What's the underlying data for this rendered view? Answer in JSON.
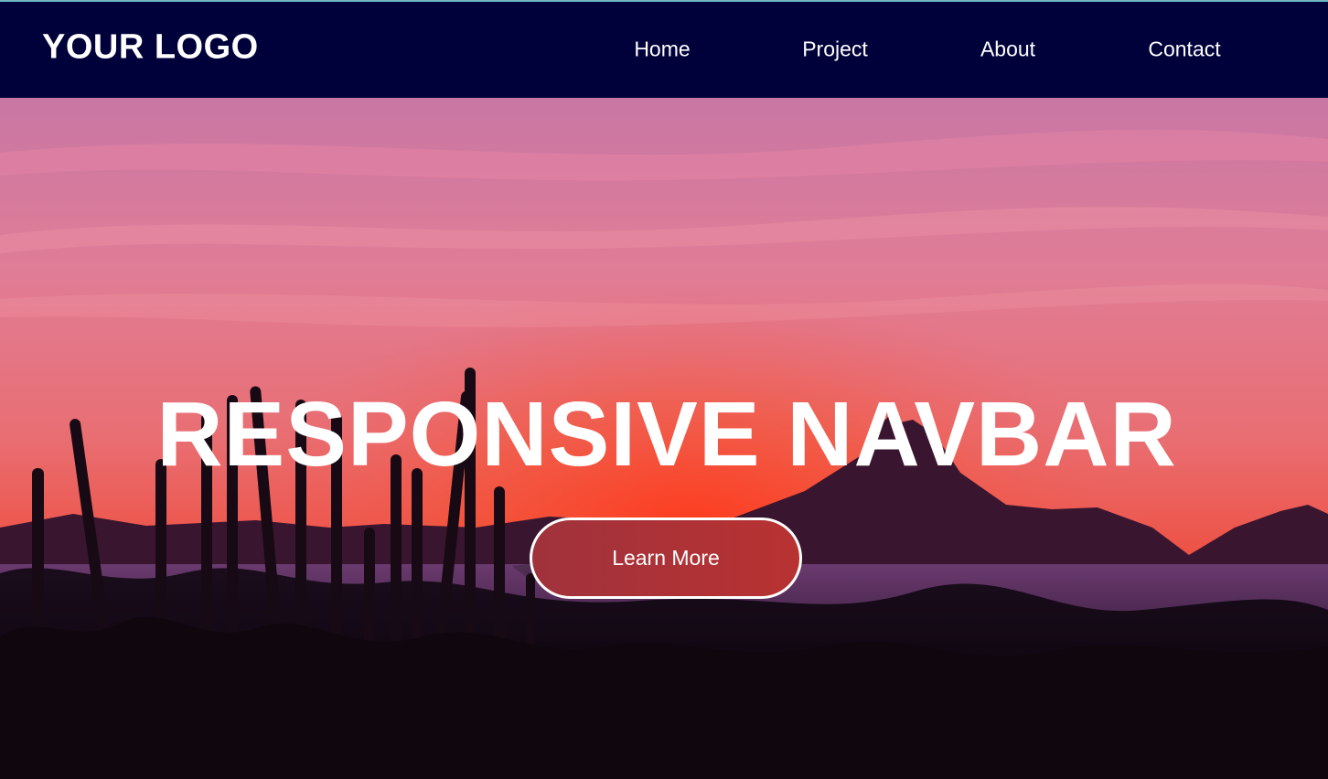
{
  "navbar": {
    "logo": "YOUR LOGO",
    "links": [
      "Home",
      "Project",
      "About",
      "Contact"
    ]
  },
  "hero": {
    "title": "RESPONSIVE NAVBAR",
    "cta_label": "Learn More"
  },
  "colors": {
    "navbar_bg": "#00003a",
    "text": "#ffffff",
    "button_bg": "#b03234",
    "sky_top": "#c976a3",
    "sky_glow": "#ff4a2e"
  },
  "icons": {
    "background": "sunset-cactus-landscape-image"
  }
}
